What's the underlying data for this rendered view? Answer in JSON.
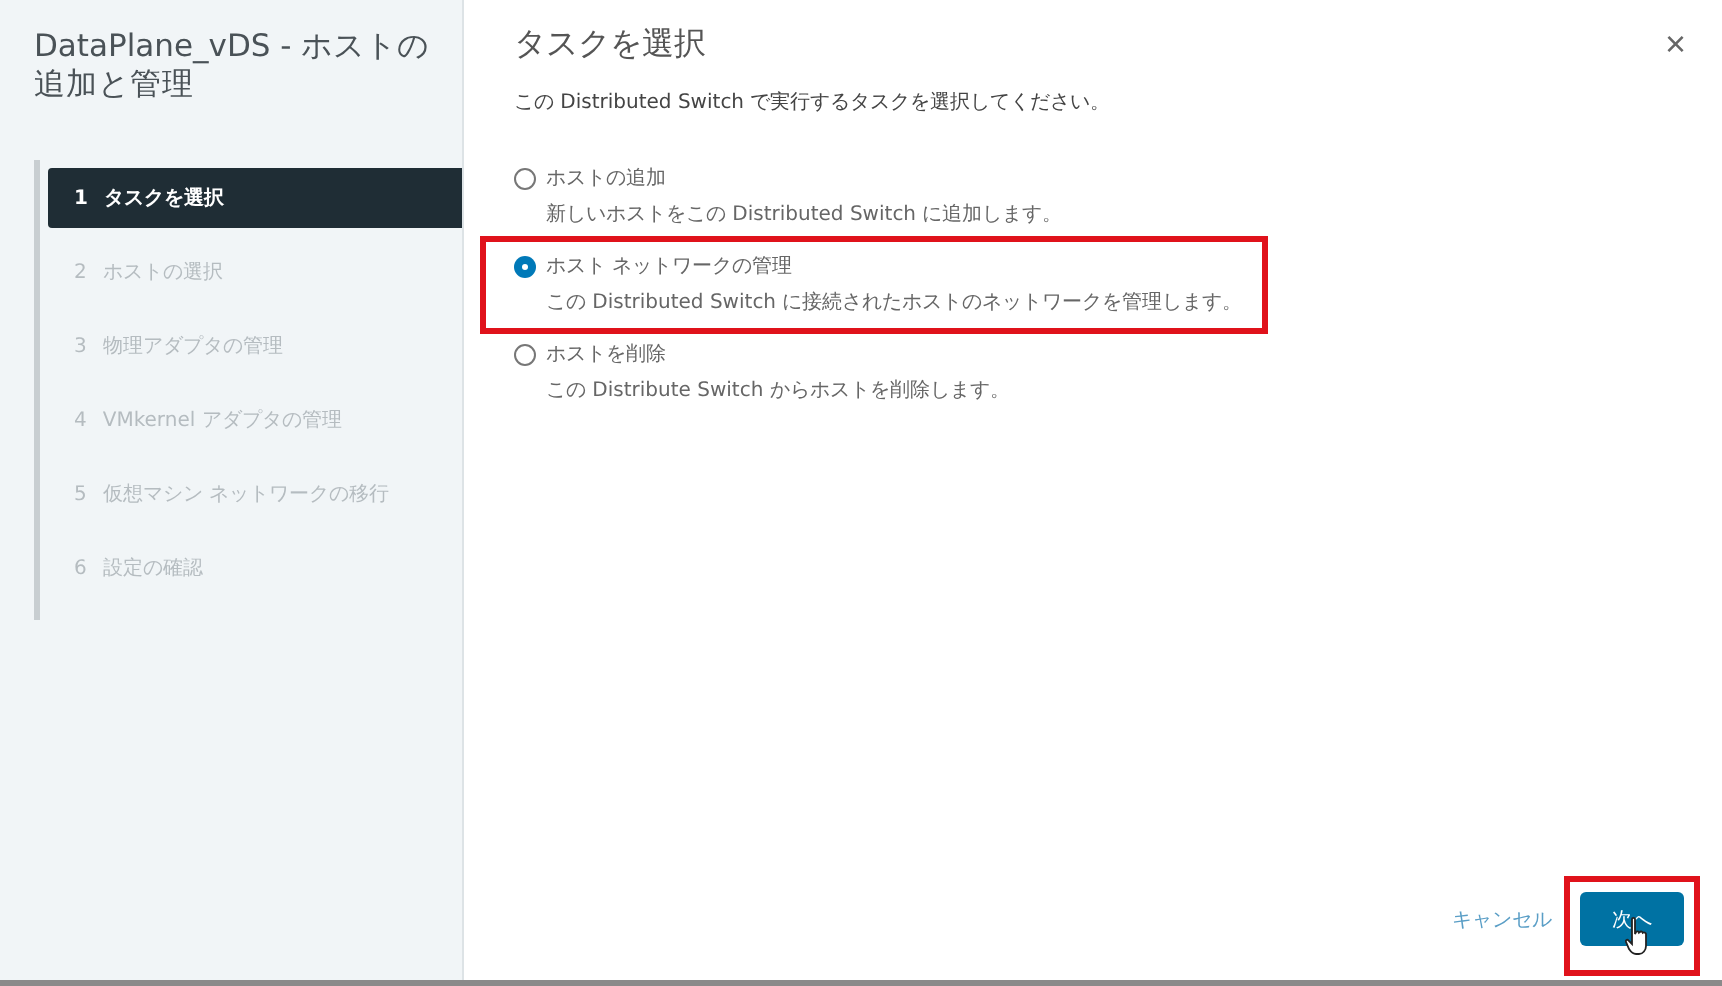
{
  "sidebar": {
    "title": "DataPlane_vDS - ホストの追加と管理",
    "steps": [
      {
        "number": "1",
        "label": "タスクを選択",
        "selected": true
      },
      {
        "number": "2",
        "label": "ホストの選択",
        "selected": false
      },
      {
        "number": "3",
        "label": "物理アダプタの管理",
        "selected": false
      },
      {
        "number": "4",
        "label": "VMkernel アダプタの管理",
        "selected": false
      },
      {
        "number": "5",
        "label": "仮想マシン ネットワークの移行",
        "selected": false
      },
      {
        "number": "6",
        "label": "設定の確認",
        "selected": false
      }
    ]
  },
  "main": {
    "title": "タスクを選択",
    "close": "×",
    "description": "この Distributed Switch で実行するタスクを選択してください。",
    "options": [
      {
        "label": "ホストの追加",
        "description": "新しいホストをこの Distributed Switch に追加します。",
        "selected": false,
        "highlighted": false
      },
      {
        "label": "ホスト ネットワークの管理",
        "description": "この Distributed Switch に接続されたホストのネットワークを管理します。",
        "selected": true,
        "highlighted": true
      },
      {
        "label": "ホストを削除",
        "description": "この Distribute Switch からホストを削除します。",
        "selected": false,
        "highlighted": false
      }
    ]
  },
  "footer": {
    "cancel": "キャンセル",
    "next": {
      "label": "次へ",
      "highlighted": true
    }
  }
}
